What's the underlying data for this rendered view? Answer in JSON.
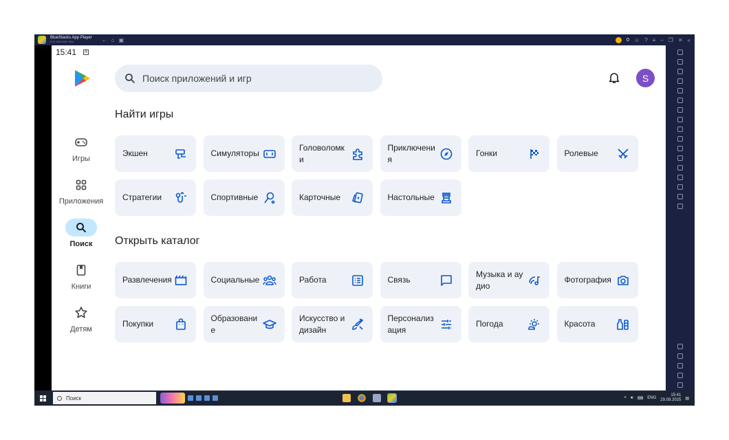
{
  "window": {
    "title": "BlueStacks App Player",
    "subtitle": "5.21.500.1021 P64",
    "coin_count": "0"
  },
  "status": {
    "time": "15:41",
    "indicator": "A"
  },
  "search": {
    "placeholder": "Поиск приложений и игр"
  },
  "account": {
    "avatar_letter": "S"
  },
  "nav": [
    {
      "label": "Игры",
      "icon": "gamepad-icon",
      "active": false
    },
    {
      "label": "Приложения",
      "icon": "apps-grid-icon",
      "active": false
    },
    {
      "label": "Поиск",
      "icon": "search-icon",
      "active": true
    },
    {
      "label": "Книги",
      "icon": "book-icon",
      "active": false
    },
    {
      "label": "Детям",
      "icon": "star-icon",
      "active": false
    }
  ],
  "games_section": {
    "title": "Найти игры",
    "tiles": [
      {
        "label": "Экшен",
        "icon": "action-icon"
      },
      {
        "label": "Симуляторы",
        "icon": "simulator-icon"
      },
      {
        "label": "Головоломки",
        "icon": "puzzle-icon"
      },
      {
        "label": "Приключения",
        "icon": "compass-icon"
      },
      {
        "label": "Гонки",
        "icon": "race-flag-icon"
      },
      {
        "label": "Ролевые",
        "icon": "swords-icon"
      },
      {
        "label": "Стратегии",
        "icon": "strategy-icon"
      },
      {
        "label": "Спортивные",
        "icon": "sport-icon"
      },
      {
        "label": "Карточные",
        "icon": "cards-icon"
      },
      {
        "label": "Настольные",
        "icon": "chess-rook-icon"
      }
    ]
  },
  "catalog_section": {
    "title": "Открыть каталог",
    "tiles": [
      {
        "label": "Развлечения",
        "icon": "clapperboard-icon"
      },
      {
        "label": "Социальные",
        "icon": "people-icon"
      },
      {
        "label": "Работа",
        "icon": "list-icon"
      },
      {
        "label": "Связь",
        "icon": "chat-icon"
      },
      {
        "label": "Музыка и аудио",
        "icon": "music-note-icon"
      },
      {
        "label": "Фотография",
        "icon": "camera-icon"
      },
      {
        "label": "Покупки",
        "icon": "shopping-bag-icon"
      },
      {
        "label": "Образование",
        "icon": "graduation-cap-icon"
      },
      {
        "label": "Искусство и дизайн",
        "icon": "brush-icon"
      },
      {
        "label": "Персонализация",
        "icon": "sliders-icon"
      },
      {
        "label": "Погода",
        "icon": "weather-icon"
      },
      {
        "label": "Красота",
        "icon": "beauty-icon"
      }
    ]
  },
  "taskbar": {
    "search_placeholder": "Поиск",
    "language": "ENG",
    "time": "15:41",
    "date": "29.09.2025"
  },
  "colors": {
    "accent": "#1a73e8",
    "icon": "#0b57d0",
    "tile_bg": "#eef2f8",
    "search_bg": "#e9eef6",
    "nav_active": "#c2e7ff",
    "avatar": "#7b4fc7"
  }
}
